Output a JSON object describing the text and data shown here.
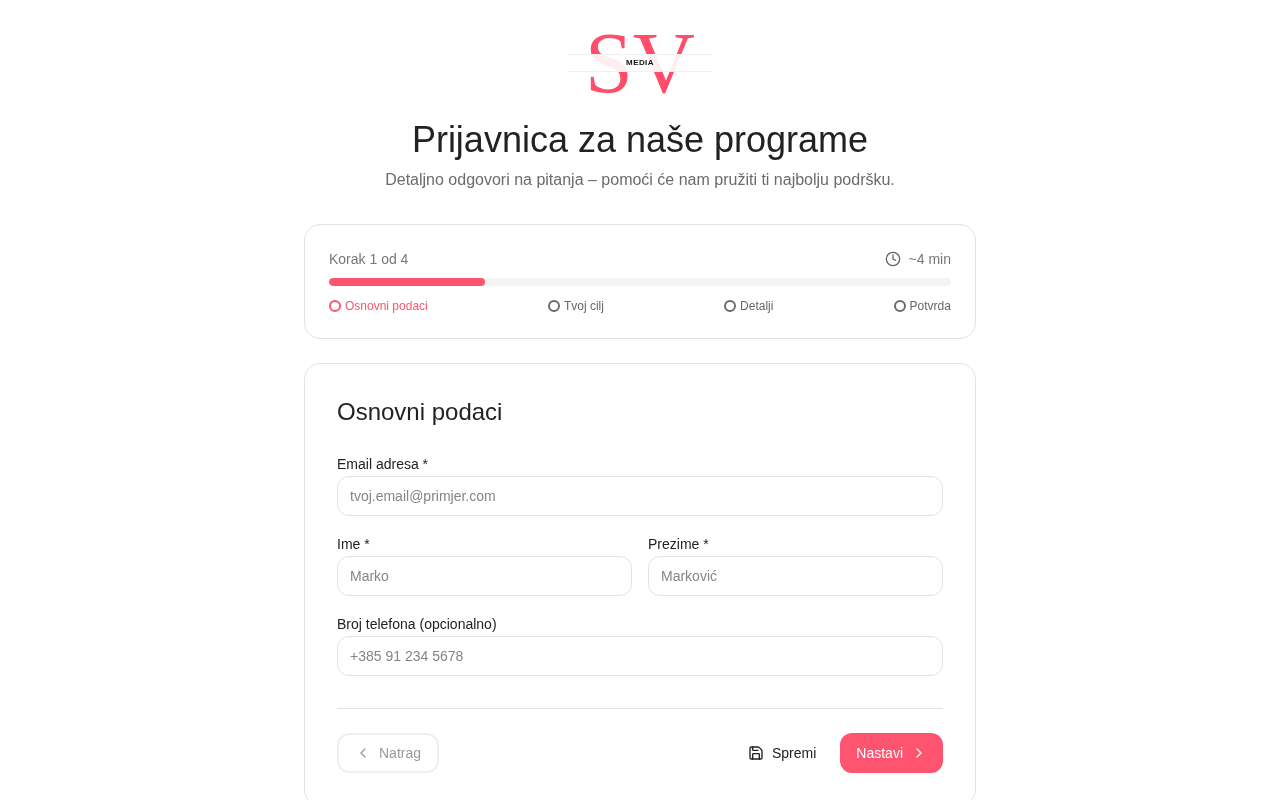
{
  "logo": {
    "letters": "SV",
    "tagline": "MEDIA"
  },
  "header": {
    "title": "Prijavnica za naše programe",
    "subtitle": "Detaljno odgovori na pitanja – pomoći će nam pružiti ti najbolju podršku."
  },
  "progress": {
    "step_label": "Korak 1 od 4",
    "time": "~4 min",
    "level": 0.25,
    "steps": [
      {
        "label": "Osnovni podaci",
        "selected": true
      },
      {
        "label": "Tvoj cilj",
        "selected": false
      },
      {
        "label": "Detalji",
        "selected": false
      },
      {
        "label": "Potvrda",
        "selected": false
      }
    ]
  },
  "form": {
    "title": "Osnovni podaci",
    "rows": [
      {
        "fields": [
          {
            "label": "Email adresa *",
            "placeholder": "tvoj.email@primjer.com"
          }
        ]
      },
      {
        "fields": [
          {
            "label": "Ime *",
            "placeholder": "Marko"
          },
          {
            "label": "Prezime *",
            "placeholder": "Marković"
          }
        ]
      },
      {
        "fields": [
          {
            "label": "Broj telefona (opcionalno)",
            "placeholder": "+385 91 234 5678"
          }
        ]
      }
    ]
  },
  "actions": {
    "back": {
      "label": "Natrag",
      "disabled": true
    },
    "save": {
      "label": "Spremi"
    },
    "next": {
      "label": "Nastavi"
    }
  }
}
